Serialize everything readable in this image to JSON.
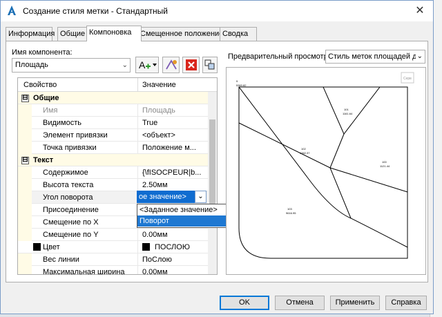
{
  "window": {
    "title": "Создание стиля метки - Стандартный",
    "app_icon": "autocad-a-icon",
    "close_icon": "close-icon"
  },
  "tabs": [
    {
      "label": "Информация",
      "active": false
    },
    {
      "label": "Общие",
      "active": false
    },
    {
      "label": "Компоновка",
      "active": true
    },
    {
      "label": "Смещенное положение",
      "active": false
    },
    {
      "label": "Сводка",
      "active": false
    }
  ],
  "component": {
    "label": "Имя компонента:",
    "value": "Площадь",
    "tools": [
      "add-component-icon",
      "copy-component-icon",
      "delete-component-icon",
      "draw-order-icon"
    ]
  },
  "grid": {
    "headers": {
      "property": "Свойство",
      "value": "Значение"
    },
    "rows": [
      {
        "type": "category",
        "name": "Общие",
        "expander": "⊟"
      },
      {
        "type": "prop",
        "name": "Имя",
        "value": "Площадь",
        "disabled": true
      },
      {
        "type": "prop",
        "name": "Видимость",
        "value": "True"
      },
      {
        "type": "prop",
        "name": "Элемент привязки",
        "value": "<объект>"
      },
      {
        "type": "prop",
        "name": "Точка привязки",
        "value": "Положение м..."
      },
      {
        "type": "category",
        "name": "Текст",
        "expander": "⊟"
      },
      {
        "type": "prop",
        "name": "Содержимое",
        "value": "{\\fISOCPEUR|b..."
      },
      {
        "type": "prop",
        "name": "Высота текста",
        "value": "2.50мм"
      },
      {
        "type": "prop",
        "name": "Угол поворота",
        "value": ""
      },
      {
        "type": "prop",
        "name": "Присоединение",
        "value": ""
      },
      {
        "type": "prop",
        "name": "Смещение по X",
        "value": ""
      },
      {
        "type": "prop",
        "name": "Смещение по Y",
        "value": "0.00мм"
      },
      {
        "type": "prop",
        "name": "Цвет",
        "value": "ПОСЛОЮ",
        "swatch": "#000000"
      },
      {
        "type": "prop",
        "name": "Вес линии",
        "value": "ПоСлою"
      },
      {
        "type": "prop",
        "name": "Максимальная ширина",
        "value": "0.00мм"
      }
    ],
    "edit_value": "ое значение>",
    "dropdown_options": [
      {
        "label": "<Заданное значение>",
        "selected": false
      },
      {
        "label": "Поворот",
        "selected": true
      }
    ]
  },
  "preview": {
    "label": "Предварительный просмотр",
    "style_value": "Стиль меток площадей д",
    "ext_icon": "preview-extents-icon",
    "sample_labels": [
      {
        "id": "9",
        "val": "5363.82"
      },
      {
        "id": "101",
        "val": "1161.64"
      },
      {
        "id": "102",
        "val": "1362.37"
      },
      {
        "id": "100",
        "val": "1121.44"
      },
      {
        "id": "103",
        "val": "9616.95"
      }
    ]
  },
  "buttons": {
    "ok": "OK",
    "cancel": "Отмена",
    "apply": "Применить",
    "help": "Справка"
  },
  "colors": {
    "selection": "#1e78d2",
    "category_bg": "#fffbe6",
    "ok_border": "#0078d7"
  }
}
